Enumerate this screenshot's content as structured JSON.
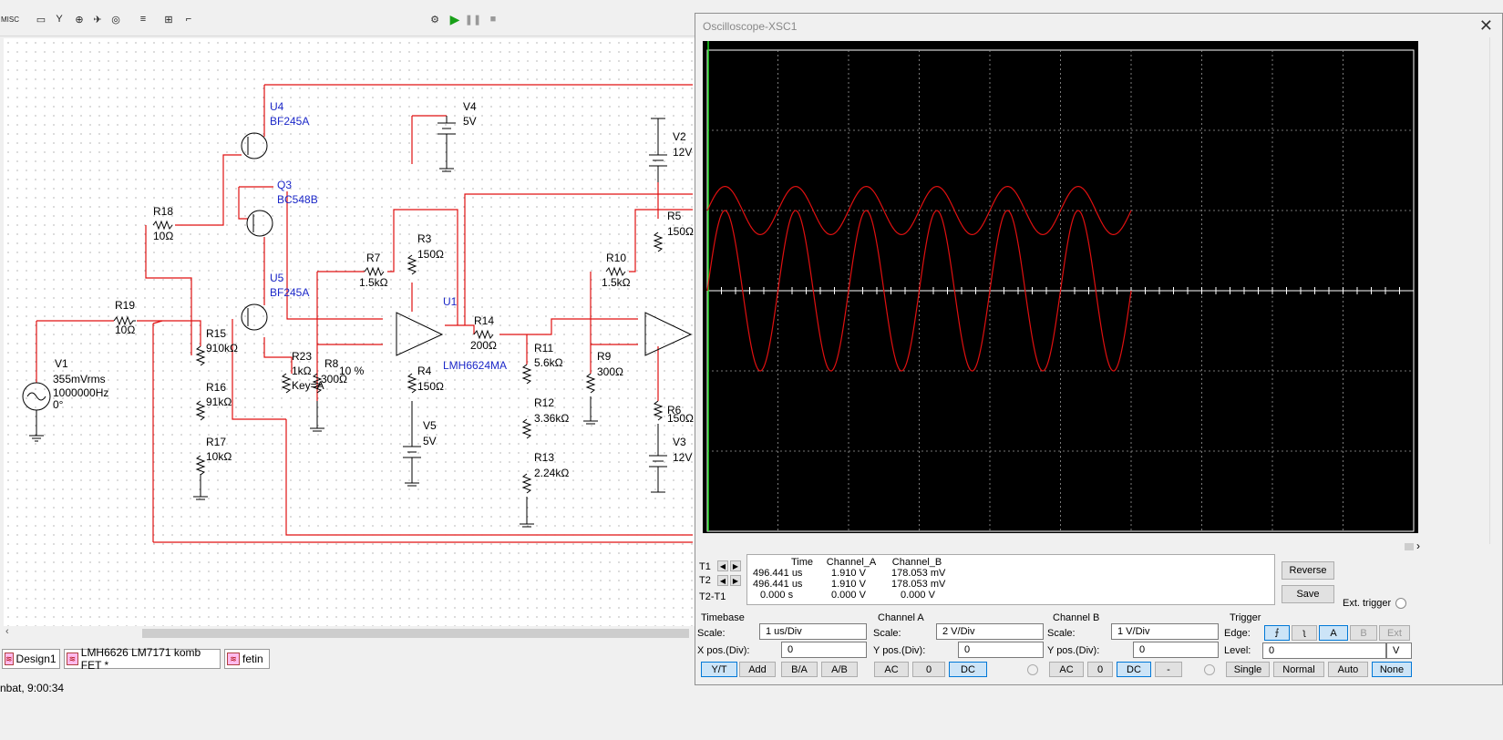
{
  "toolbar": {
    "icons": [
      "misc-icon",
      "monitor-icon",
      "antenna-icon",
      "part-icon",
      "fan-icon",
      "probe-icon",
      "bus-icon",
      "netlist-icon",
      "step-icon"
    ],
    "misc_label": "MISC"
  },
  "schematic": {
    "labels": {
      "u4_ref": "U4",
      "u4_val": "BF245A",
      "q3_ref": "Q3",
      "q3_val": "BC548B",
      "u5_ref": "U5",
      "u5_val": "BF245A",
      "r18_ref": "R18",
      "r18_val": "10Ω",
      "r19_ref": "R19",
      "r19_val": "10Ω",
      "v1_ref": "V1",
      "v1_l1": "355mVrms",
      "v1_l2": "1000000Hz",
      "v1_l3": "0°",
      "r15_ref": "R15",
      "r15_val": "910kΩ",
      "r16_ref": "R16",
      "r16_val": "91kΩ",
      "r17_ref": "R17",
      "r17_val": "10kΩ",
      "r23_ref": "R23",
      "r23_val": "1kΩ",
      "r23_key": "Key=A",
      "r23_pct": "10 %",
      "r8_ref": "R8",
      "r8_val": "300Ω",
      "r7_ref": "R7",
      "r7_val": "1.5kΩ",
      "r3_ref": "R3",
      "r3_val": "150Ω",
      "r4_ref": "R4",
      "r4_val": "150Ω",
      "v4_ref": "V4",
      "v4_val": "5V",
      "v5_ref": "V5",
      "v5_val": "5V",
      "u1_ref": "U1",
      "u1_val": "LMH6624MA",
      "r14_ref": "R14",
      "r14_val": "200Ω",
      "r11_ref": "R11",
      "r11_val": "5.6kΩ",
      "r12_ref": "R12",
      "r12_val": "3.36kΩ",
      "r13_ref": "R13",
      "r13_val": "2.24kΩ",
      "r10_ref": "R10",
      "r10_val": "1.5kΩ",
      "r9_ref": "R9",
      "r9_val": "300Ω",
      "v2_ref": "V2",
      "v2_val": "12V",
      "r5_ref": "R5",
      "r5_val": "150Ω",
      "r6_ref": "R6",
      "r6_val": "150Ω",
      "v3_ref": "V3",
      "v3_val": "12V"
    }
  },
  "tabs": [
    {
      "label": "Design1"
    },
    {
      "label": "LMH6626 LM7171 komb FET *"
    },
    {
      "label": "fetin"
    }
  ],
  "status_text": "nbat, 9:00:34",
  "oscilloscope": {
    "title": "Oscilloscope-XSC1",
    "readout": {
      "headers": [
        "Time",
        "Channel_A",
        "Channel_B"
      ],
      "rows": [
        {
          "label": "T1",
          "time": "496.441 us",
          "a": "1.910 V",
          "b": "178.053 mV"
        },
        {
          "label": "T2",
          "time": "496.441 us",
          "a": "1.910 V",
          "b": "178.053 mV"
        },
        {
          "label": "T2-T1",
          "time": "0.000 s",
          "a": "0.000 V",
          "b": "0.000 V"
        }
      ]
    },
    "reverse_label": "Reverse",
    "save_label": "Save",
    "ext_trigger_label": "Ext. trigger",
    "timebase": {
      "title": "Timebase",
      "scale_label": "Scale:",
      "scale": "1 us/Div",
      "xpos_label": "X pos.(Div):",
      "xpos": "0",
      "buttons": [
        "Y/T",
        "Add",
        "B/A",
        "A/B"
      ],
      "selected": "Y/T"
    },
    "channel_a": {
      "title": "Channel A",
      "scale_label": "Scale:",
      "scale": "2  V/Div",
      "ypos_label": "Y pos.(Div):",
      "ypos": "0",
      "buttons": [
        "AC",
        "0",
        "DC"
      ],
      "selected": "DC"
    },
    "channel_b": {
      "title": "Channel B",
      "scale_label": "Scale:",
      "scale": "1  V/Div",
      "ypos_label": "Y pos.(Div):",
      "ypos": "0",
      "buttons": [
        "AC",
        "0",
        "DC",
        "-"
      ],
      "selected": "DC"
    },
    "trigger": {
      "title": "Trigger",
      "edge_label": "Edge:",
      "level_label": "Level:",
      "level": "0",
      "unit": "V",
      "sources": [
        "A",
        "B",
        "Ext"
      ],
      "selected_source": "A",
      "modes": [
        "Single",
        "Normal",
        "Auto",
        "None"
      ],
      "selected_mode": "None"
    },
    "traces": {
      "color": "#e01010",
      "channel_a": {
        "amplitude_div": 0.3,
        "offset_div": 1.0,
        "cycles": 6,
        "period_div": 1.0
      },
      "channel_b": {
        "amplitude_div": 1.0,
        "offset_div": 0,
        "cycles": 6,
        "period_div": 1.0
      }
    }
  }
}
